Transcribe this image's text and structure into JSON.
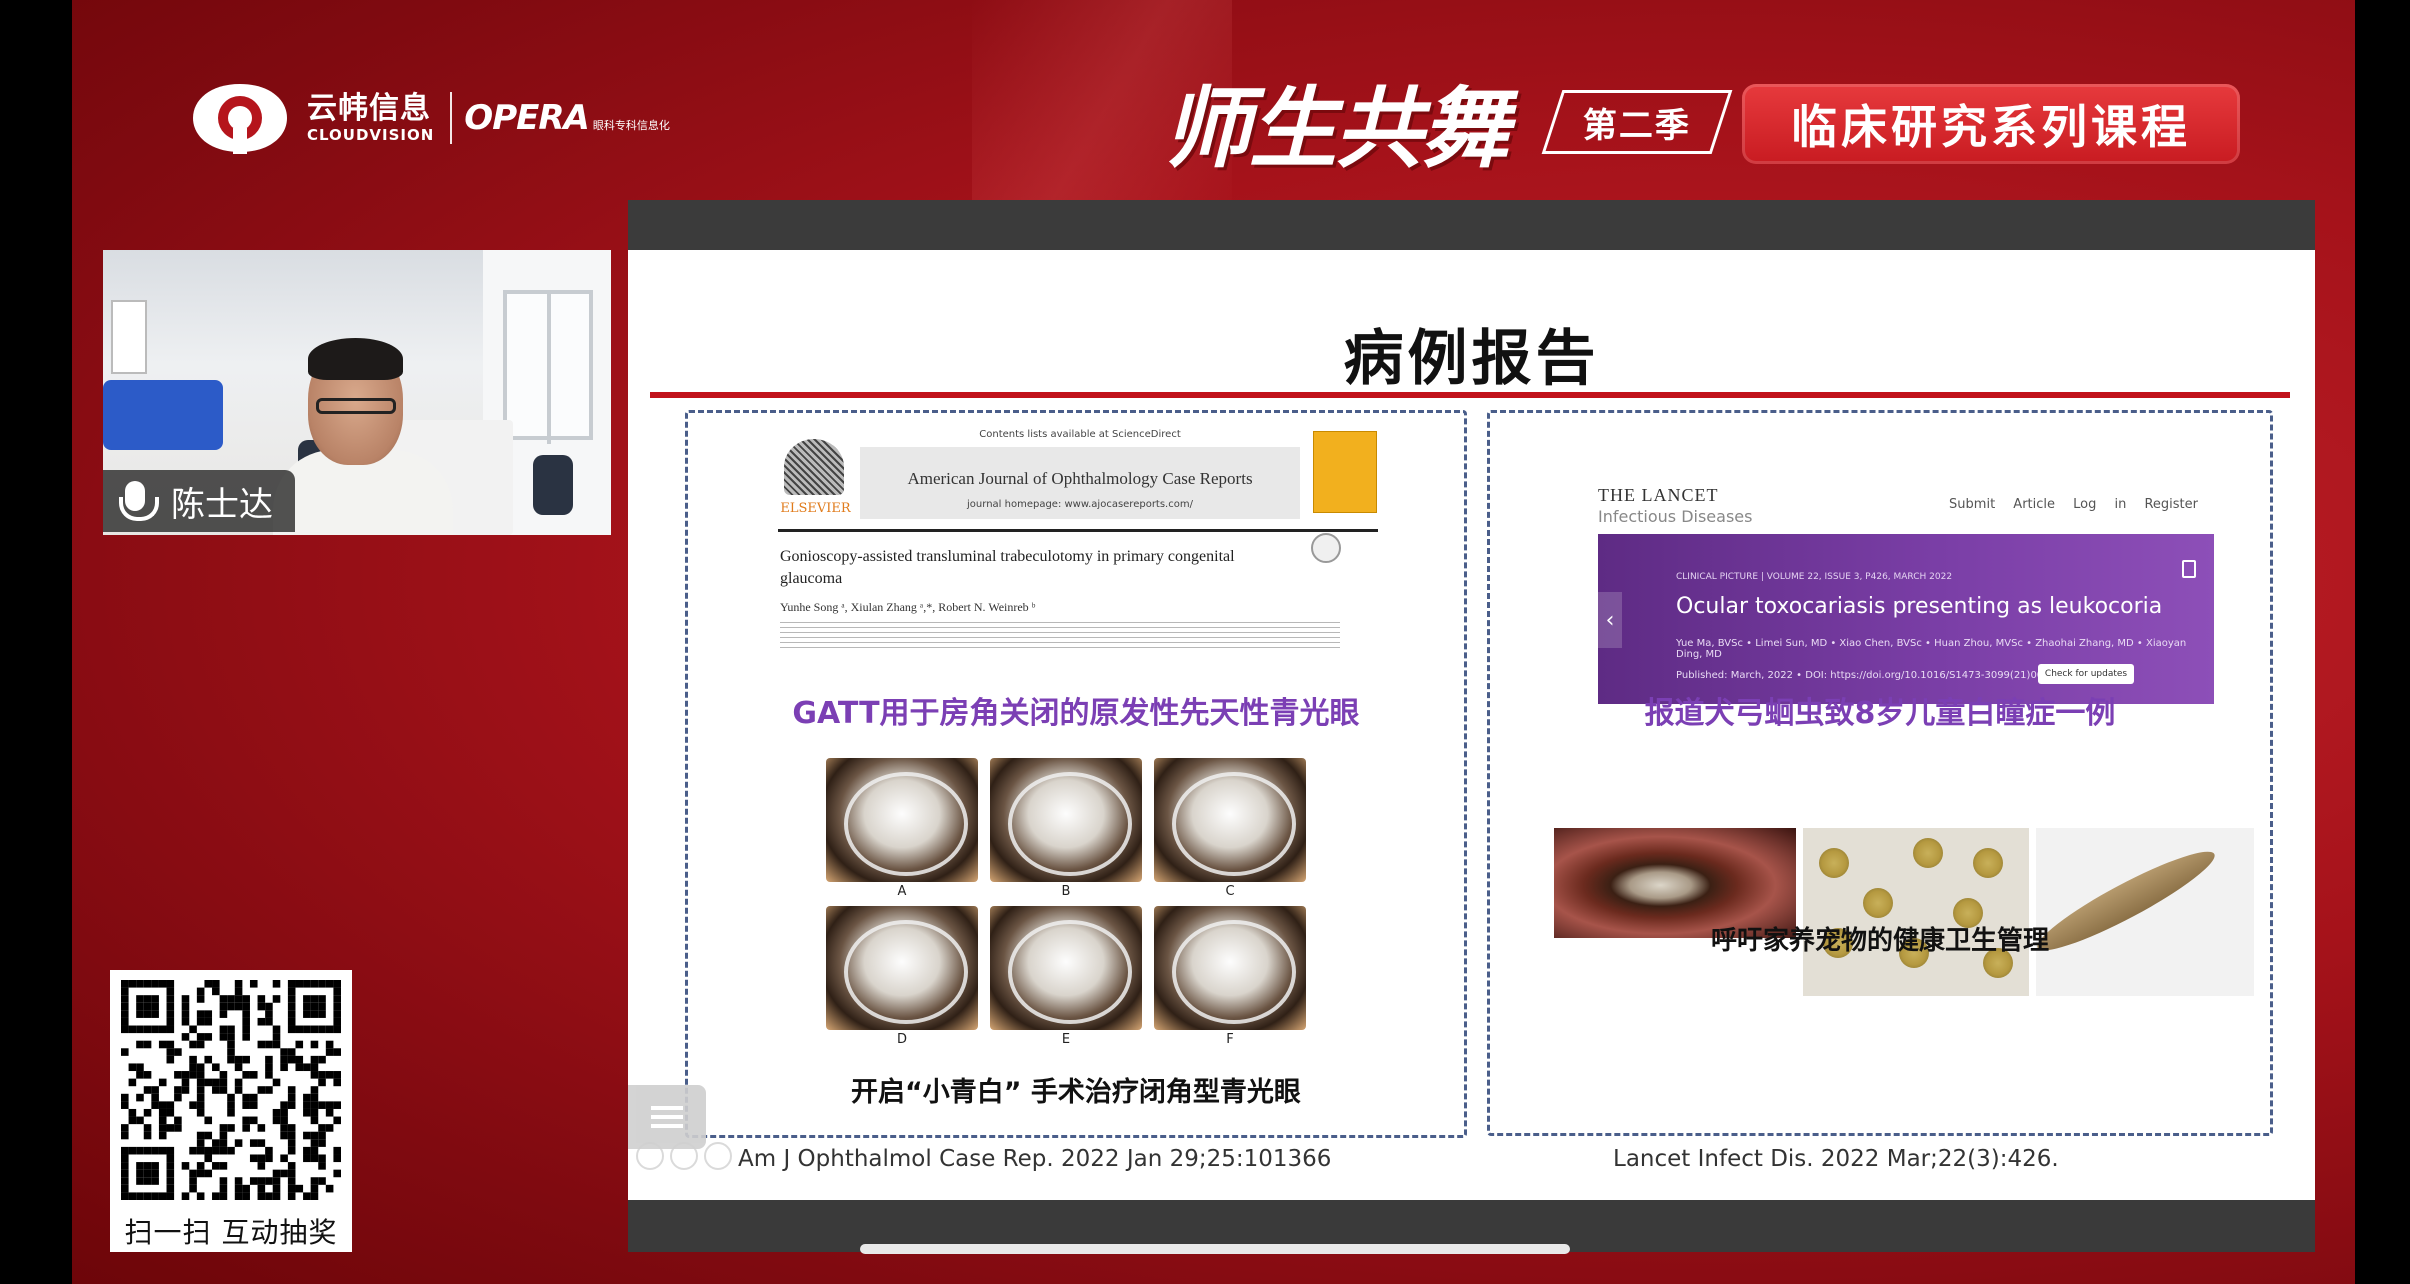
{
  "header": {
    "logo_cn": "云帏信息",
    "logo_en": "CLOUDVISION",
    "logo_opera": "OPERA",
    "logo_opera_sub": "眼科专科信息化",
    "series_title": "师生共舞",
    "season": "第二季",
    "course": "临床研究系列课程"
  },
  "webcam": {
    "speaker_name": "陈士达",
    "mic_icon": "microphone-icon"
  },
  "qr": {
    "label": "扫一扫  互动抽奖"
  },
  "slide": {
    "title": "病例报告",
    "left": {
      "journal_available": "Contents lists available at ScienceDirect",
      "journal_name": "American Journal of Ophthalmology Case Reports",
      "journal_homepage": "journal homepage: www.ajocasereports.com/",
      "publisher": "ELSEVIER",
      "article_title": "Gonioscopy-assisted transluminal trabeculotomy in primary congenital glaucoma",
      "authors": "Yunhe Song ᵃ, Xiulan Zhang ᵃ,*, Robert N. Weinreb ᵇ",
      "caption": "GATT用于房角关闭的原发性先天性青光眼",
      "figure_labels": [
        "A",
        "B",
        "C",
        "D",
        "E",
        "F"
      ],
      "bottom_text": "开启“小青白” 手术治疗闭角型青光眼",
      "citation": "Am J Ophthalmol Case Rep. 2022 Jan 29;25:101366"
    },
    "right": {
      "journal_line1": "THE LANCET",
      "journal_line2": "Infectious Diseases",
      "nav": "Submit Article  Log in  Register",
      "banner_meta": "CLINICAL PICTURE | VOLUME 22, ISSUE 3, P426, MARCH 2022",
      "banner_title": "Ocular toxocariasis presenting as leukocoria",
      "banner_authors": "Yue Ma, BVSc • Limei Sun, MD • Xiao Chen, BVSc • Huan Zhou, MVSc • Zhaohai Zhang, MD • Xiaoyan Ding, MD",
      "banner_published": "Published: March, 2022 • DOI: https://doi.org/10.1016/S1473-3099(21)00704-0",
      "check_updates": "Check for updates",
      "caption": "报道犬弓蛔虫致8岁儿童白瞳症一例",
      "bottom_text": "呼吁家养宠物的健康卫生管理",
      "citation": "Lancet Infect Dis. 2022 Mar;22(3):426."
    }
  }
}
